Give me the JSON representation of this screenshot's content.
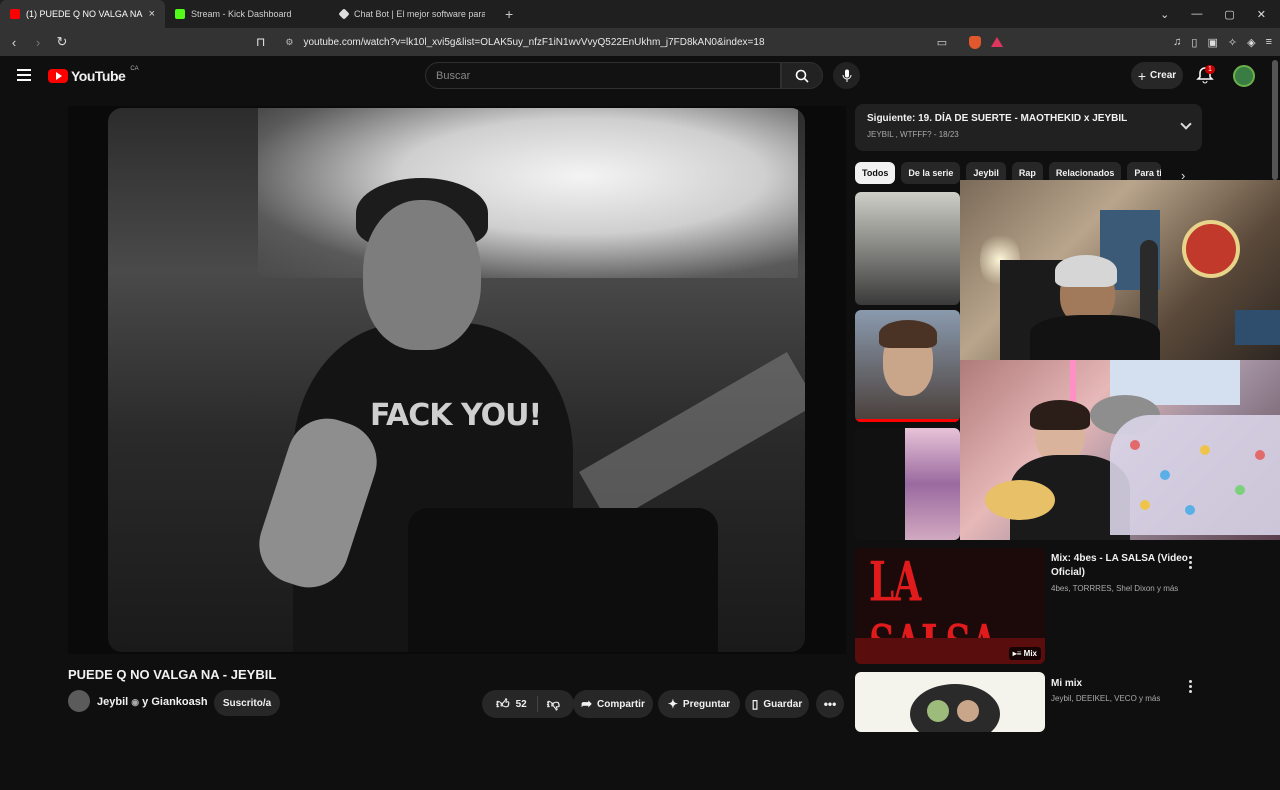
{
  "browser": {
    "tabs": [
      {
        "title": "(1) PUEDE Q NO VALGA NA - JEYBIL",
        "favicon_color": "#ff0000",
        "active": true
      },
      {
        "title": "Stream - Kick Dashboard",
        "favicon_color": "#53fc18",
        "active": false
      },
      {
        "title": "Chat Bot | El mejor software para po",
        "favicon_color": "#dddddd",
        "active": false
      }
    ],
    "new_tab": "+",
    "close": "×",
    "url": "youtube.com/watch?v=lk10l_xvi5g&list=OLAK5uy_nfzF1iN1wvVvyQ522EnUkhm_j7FD8kAN0&index=18"
  },
  "youtube": {
    "logo_text": "YouTube",
    "country_code": "CA",
    "search_placeholder": "Buscar",
    "create_label": "Crear",
    "notification_count": "1"
  },
  "video": {
    "title": "PUEDE Q NO VALGA NA - JEYBIL",
    "shirt_text": "FACK YOU!",
    "channel": "Jeybil",
    "channel_suffix": "y Giankoash",
    "subscribed_label": "Suscrito/a",
    "likes": "52",
    "share_label": "Compartir",
    "ask_label": "Preguntar",
    "save_label": "Guardar"
  },
  "sidebar": {
    "next_label": "Siguiente:",
    "next_title": "19. DÍA DE SUERTE - MAOTHEKID x JEYBIL",
    "next_sub": "JEYBIL , WTFFF? - 18/23",
    "chips": [
      "Todos",
      "De la serie",
      "Jeybil",
      "Rap",
      "Relacionados",
      "Para ti"
    ],
    "items": [
      {
        "title": "Mix: 4bes - LA SALSA (Video Oficial)",
        "subtitle": "4bes, TORRRES, Shel Dixon y más",
        "thumb_text": "LA SALSA",
        "badge": "Mix"
      },
      {
        "title": "Mi mix",
        "subtitle": "Jeybil, DEEIKEL, VECO y más"
      }
    ]
  },
  "colors": {
    "accent": "#ff0000",
    "background": "#0f0f0f"
  }
}
